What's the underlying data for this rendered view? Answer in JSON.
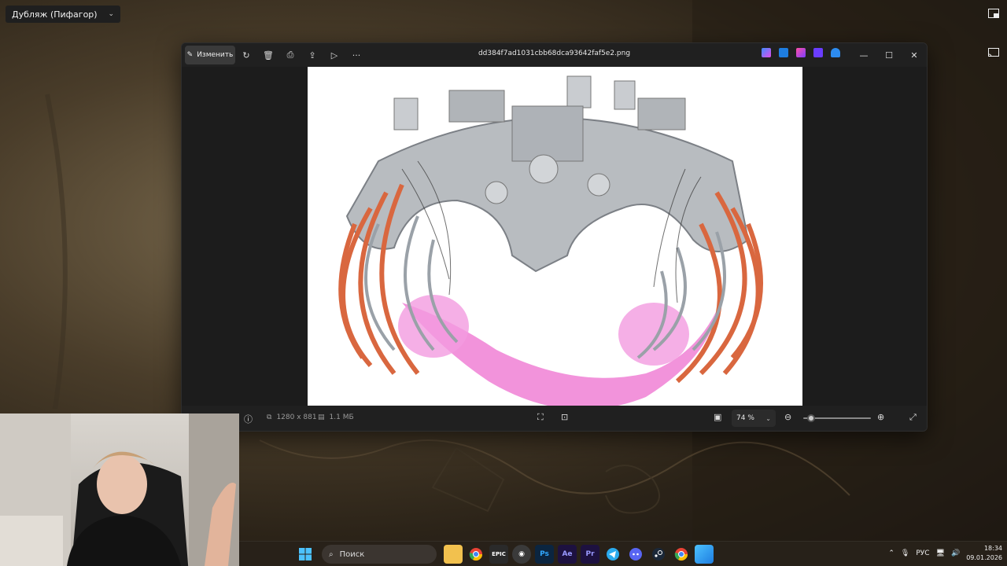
{
  "overlay": {
    "dub_label": "Дубляж (Пифагор)"
  },
  "viewer": {
    "edit_label": "Изменить",
    "file_name": "dd384f7ad1031cbb68dca93642faf5e2.png",
    "dimensions": "1280 x 881",
    "file_size": "1.1 МБ",
    "zoom": "74 %",
    "zoom_level": 0.12
  },
  "taskbar": {
    "search_placeholder": "Поиск",
    "language": "РУС",
    "time": "18:34",
    "date": "09.01.2026",
    "apps": [
      {
        "icon": "start-icon"
      },
      {
        "icon": "file-explorer-icon"
      },
      {
        "icon": "chrome-icon"
      },
      {
        "icon": "epic-games-icon",
        "label": "EPIC"
      },
      {
        "icon": "obs-icon"
      },
      {
        "icon": "photoshop-icon",
        "label": "Ps"
      },
      {
        "icon": "after-effects-icon",
        "label": "Ae"
      },
      {
        "icon": "premiere-icon",
        "label": "Pr"
      },
      {
        "icon": "telegram-icon"
      },
      {
        "icon": "discord-icon"
      },
      {
        "icon": "steam-icon"
      },
      {
        "icon": "chrome-icon"
      },
      {
        "icon": "photos-icon"
      }
    ]
  },
  "colors": {
    "accent_orange": "#d9673f",
    "plasma_pink": "#ee6fcf",
    "window_bg": "#1c1c1c",
    "photoshop": "#0b2540",
    "after_effects": "#1d1140",
    "premiere": "#1d1140"
  }
}
